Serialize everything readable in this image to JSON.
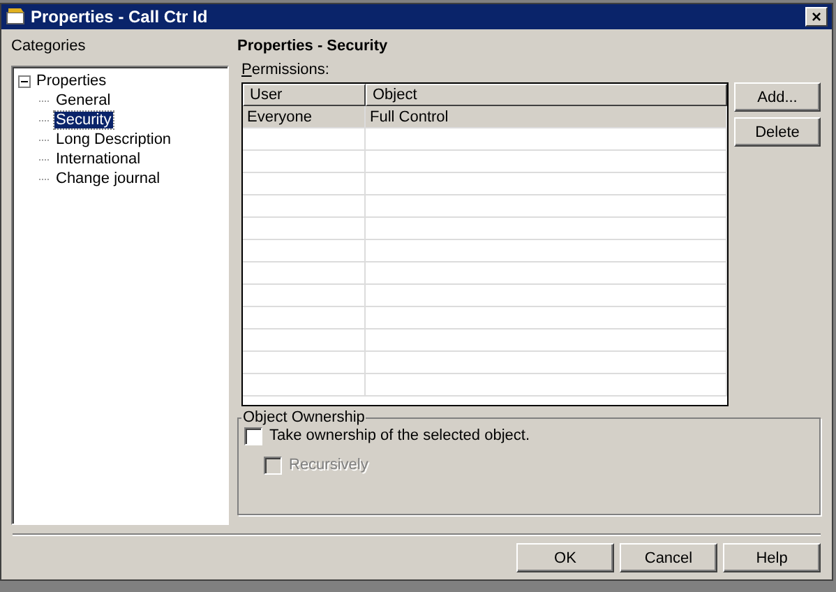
{
  "window": {
    "title": "Properties - Call Ctr Id",
    "close": "×"
  },
  "categories": {
    "label": "Categories",
    "tree": [
      {
        "label": "Properties",
        "expanded": true,
        "selected": false,
        "children": [
          {
            "label": "General",
            "selected": false
          },
          {
            "label": "Security",
            "selected": true
          },
          {
            "label": "Long Description",
            "selected": false
          },
          {
            "label": "International",
            "selected": false
          },
          {
            "label": "Change journal",
            "selected": false
          }
        ]
      }
    ]
  },
  "panel": {
    "heading": "Properties - Security",
    "permissions_label": "Permissions:",
    "table": {
      "columns": [
        "User",
        "Object"
      ],
      "rows": [
        {
          "cells": [
            "Everyone",
            "Full Control"
          ],
          "selected": true
        }
      ]
    },
    "side_buttons": [
      "Add...",
      "Delete"
    ],
    "ownership": {
      "legend": "Object Ownership",
      "options": [
        {
          "label": "Take ownership of the selected object.",
          "checked": false,
          "disabled": false,
          "nested": false
        },
        {
          "label": "Recursively",
          "checked": false,
          "disabled": true,
          "nested": true
        }
      ]
    }
  },
  "buttons": [
    "OK",
    "Cancel",
    "Help"
  ]
}
